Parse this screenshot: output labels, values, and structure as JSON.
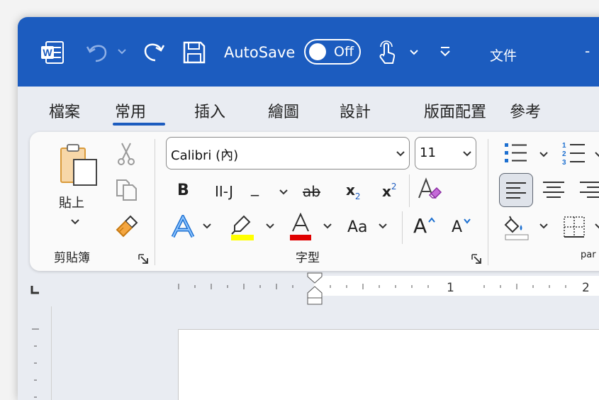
{
  "titlebar": {
    "autosave_label": "AutoSave",
    "toggle_state": "Off",
    "doc_title": "文件",
    "minimize": "-"
  },
  "tabs": [
    {
      "label": "檔案"
    },
    {
      "label": "常用"
    },
    {
      "label": "插入"
    },
    {
      "label": "繪圖"
    },
    {
      "label": "設計"
    },
    {
      "label": "版面配置"
    },
    {
      "label": "參考"
    }
  ],
  "clipboard": {
    "paste_label": "貼上",
    "group_label": "剪貼簿"
  },
  "font": {
    "font_name": "Calibri (內)",
    "font_size": "11",
    "group_label": "字型",
    "bold": "B",
    "italic": "II-J",
    "underline": "_",
    "strikethrough": "ab",
    "subscript": "x",
    "subscript_small": "2",
    "superscript": "x",
    "superscript_small": "2",
    "change_case": "Aa",
    "grow_font": "A",
    "shrink_font": "A"
  },
  "paragraph": {
    "group_label": "par"
  },
  "ruler": {
    "mark_1": "1",
    "mark_2": "2"
  },
  "colors": {
    "titlebar": "#1c5cbf",
    "highlight": "#ffff00",
    "font_color": "#e00000"
  }
}
